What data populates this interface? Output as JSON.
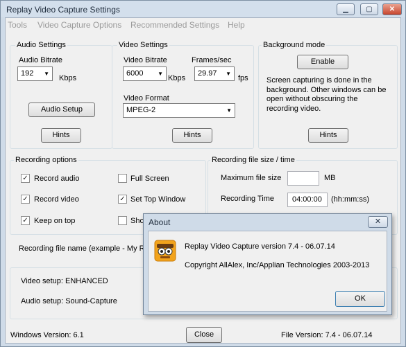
{
  "window": {
    "title": "Replay Video Capture Settings",
    "min_glyph": "▁",
    "max_glyph": "▢",
    "close_glyph": "✕"
  },
  "menu": [
    "Tools",
    "Video Capture Options",
    "Recommended Settings",
    "Help"
  ],
  "audio": {
    "group_label": "Audio Settings",
    "bitrate_label": "Audio Bitrate",
    "bitrate_value": "192",
    "bitrate_unit": "Kbps",
    "setup_button": "Audio Setup",
    "hints_button": "Hints"
  },
  "video": {
    "group_label": "Video Settings",
    "bitrate_label": "Video Bitrate",
    "bitrate_value": "6000",
    "bitrate_unit": "Kbps",
    "fps_label": "Frames/sec",
    "fps_value": "29.97",
    "fps_unit": "fps",
    "format_label": "Video Format",
    "format_value": "MPEG-2",
    "hints_button": "Hints"
  },
  "background": {
    "group_label": "Background mode",
    "enable_button": "Enable",
    "description": "Screen capturing is done in the background. Other windows can be open without obscuring the recording video.",
    "hints_button": "Hints"
  },
  "recording": {
    "group_label": "Recording options",
    "options": [
      {
        "label": "Record audio",
        "checked": "✓"
      },
      {
        "label": "Record video",
        "checked": "✓"
      },
      {
        "label": "Keep on top",
        "checked": "✓"
      },
      {
        "label": "Full Screen",
        "checked": ""
      },
      {
        "label": "Set Top Window",
        "checked": "✓"
      },
      {
        "label": "Sho",
        "checked": ""
      }
    ]
  },
  "filesize": {
    "group_label": "Recording file size / time",
    "max_label": "Maximum file size",
    "max_value": "",
    "max_unit": "MB",
    "time_label": "Recording Time",
    "time_value": "04:00:00",
    "time_unit": "(hh:mm:ss)"
  },
  "filename_label": "Recording file name (example -  My R",
  "status": {
    "video_setup": "Video setup: ENHANCED",
    "audio_setup": "Audio setup: Sound-Capture"
  },
  "footer": {
    "windows_version": "Windows Version: 6.1",
    "close_button": "Close",
    "file_version": "File Version: 7.4 - 06.07.14"
  },
  "about": {
    "title": "About",
    "close_glyph": "✕",
    "version_text": "Replay Video Capture version 7.4 - 06.07.14",
    "copyright_text": "Copyright AllAlex, Inc/Applian Technologies 2003-2013",
    "ok_button": "OK"
  },
  "colors": {
    "title_bar": "#d3dfec",
    "client_bg": "#f0f0f0",
    "close_red": "#c7452d",
    "app_icon_orange": "#f2a31c"
  }
}
